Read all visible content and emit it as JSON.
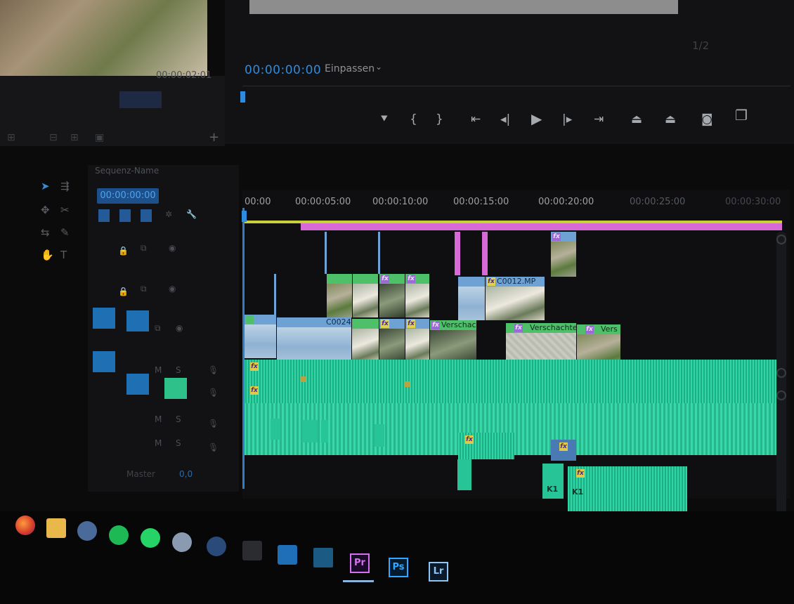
{
  "source_monitor": {
    "timecode": "00:00:02:01"
  },
  "program_monitor": {
    "timecode": "00:00:00:00",
    "fit_label": "Einpassen",
    "zoom_ratio": "1/2"
  },
  "transport": {
    "icons": [
      "marker-icon",
      "mark-in-icon",
      "mark-out-icon",
      "go-to-in-icon",
      "step-back-icon",
      "play-icon",
      "step-forward-icon",
      "go-to-out-icon",
      "lift-icon",
      "extract-icon",
      "export-frame-icon",
      "compare-icon"
    ]
  },
  "sequence": {
    "name": "Sequenz-Name",
    "timecode": "00:00:00:00",
    "master_label": "Master",
    "master_value": "0,0"
  },
  "timeline": {
    "ruler": [
      "00:00",
      "00:00:05:00",
      "00:00:10:00",
      "00:00:15:00",
      "00:00:20:00",
      "00:00:25:00",
      "00:00:30:00"
    ],
    "clips": {
      "c0012": "C0012.MP",
      "c0024": "C0024",
      "nested1": "Verschachtelt",
      "nested2": "Verschachtelt",
      "nested3": "Vers"
    },
    "fx_label": "fx",
    "audio_k1a": "K1",
    "audio_k1b": "K1"
  },
  "taskbar": {
    "apps": [
      {
        "name": "firefox",
        "color": "#e8742c"
      },
      {
        "name": "file-explorer",
        "color": "#e8b84a"
      },
      {
        "name": "app-3",
        "color": "#4a6a9a"
      },
      {
        "name": "spotify",
        "color": "#1db954"
      },
      {
        "name": "whatsapp",
        "color": "#25d366"
      },
      {
        "name": "app-6",
        "color": "#8a9ab0"
      },
      {
        "name": "steam",
        "color": "#2a4a7a"
      }
    ],
    "pr_label": "Pr",
    "ps_label": "Ps",
    "lr_label": "Lr"
  },
  "colors": {
    "accent_blue": "#2f8bdc",
    "render_pink": "#d76ad6",
    "work_area_yellow": "#c9cf3a",
    "audio_green": "#27c497"
  }
}
